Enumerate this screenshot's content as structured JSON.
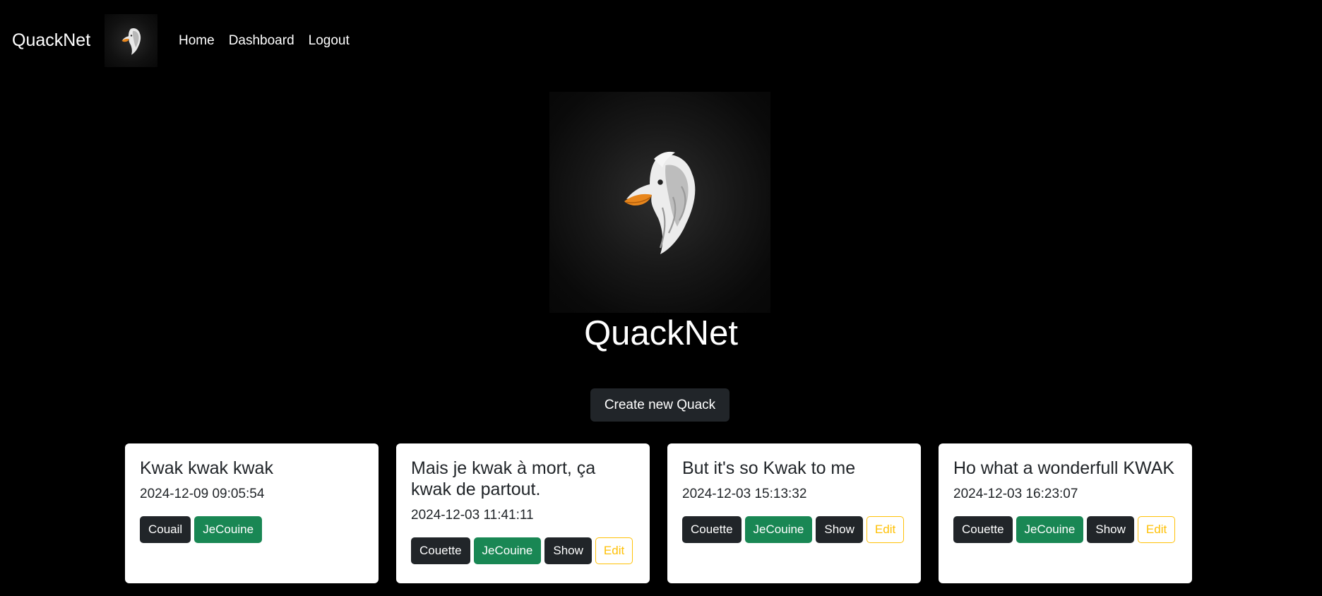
{
  "nav": {
    "brand": "QuackNet",
    "logo_icon": "duck-head-logo",
    "links": [
      "Home",
      "Dashboard",
      "Logout"
    ]
  },
  "hero": {
    "logo_icon": "duck-head-logo",
    "title": "QuackNet"
  },
  "create_button": "Create new Quack",
  "quacks": [
    {
      "title": "Kwak kwak kwak",
      "date": "2024-12-09 09:05:54",
      "buttons": [
        "Couail",
        "JeCouine"
      ]
    },
    {
      "title": "Mais je kwak à mort, ça kwak de partout.",
      "date": "2024-12-03 11:41:11",
      "buttons": [
        "Couette",
        "JeCouine",
        "Show",
        "Edit"
      ]
    },
    {
      "title": "But it's so Kwak to me",
      "date": "2024-12-03 15:13:32",
      "buttons": [
        "Couette",
        "JeCouine",
        "Show",
        "Edit"
      ]
    },
    {
      "title": "Ho what a wonderfull KWAK",
      "date": "2024-12-03 16:23:07",
      "buttons": [
        "Couette",
        "JeCouine",
        "Show",
        "Edit"
      ]
    }
  ],
  "colors": {
    "background": "#000000",
    "card": "#ffffff",
    "dark_button": "#212529",
    "green_button": "#198754",
    "edit_outline": "#ffc107"
  }
}
